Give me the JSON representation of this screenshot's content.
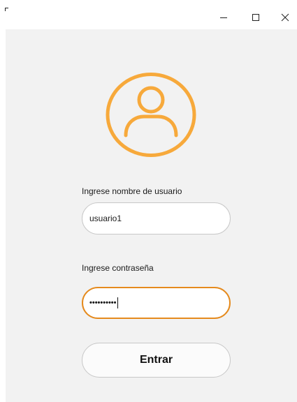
{
  "titlebar": {
    "icons": {
      "minimize": "minimize-icon",
      "maximize": "maximize-icon",
      "close": "close-icon"
    }
  },
  "avatar": {
    "icon": "user-profile-icon",
    "color": "#f7a93b"
  },
  "form": {
    "username_label": "Ingrese nombre de usuario",
    "username_value": "usuario1",
    "password_label": "Ingrese contraseña",
    "password_mask": "••••••••••",
    "submit_label": "Entrar"
  },
  "colors": {
    "focus_border": "#e58a1d",
    "client_background": "#f2f2f2"
  }
}
